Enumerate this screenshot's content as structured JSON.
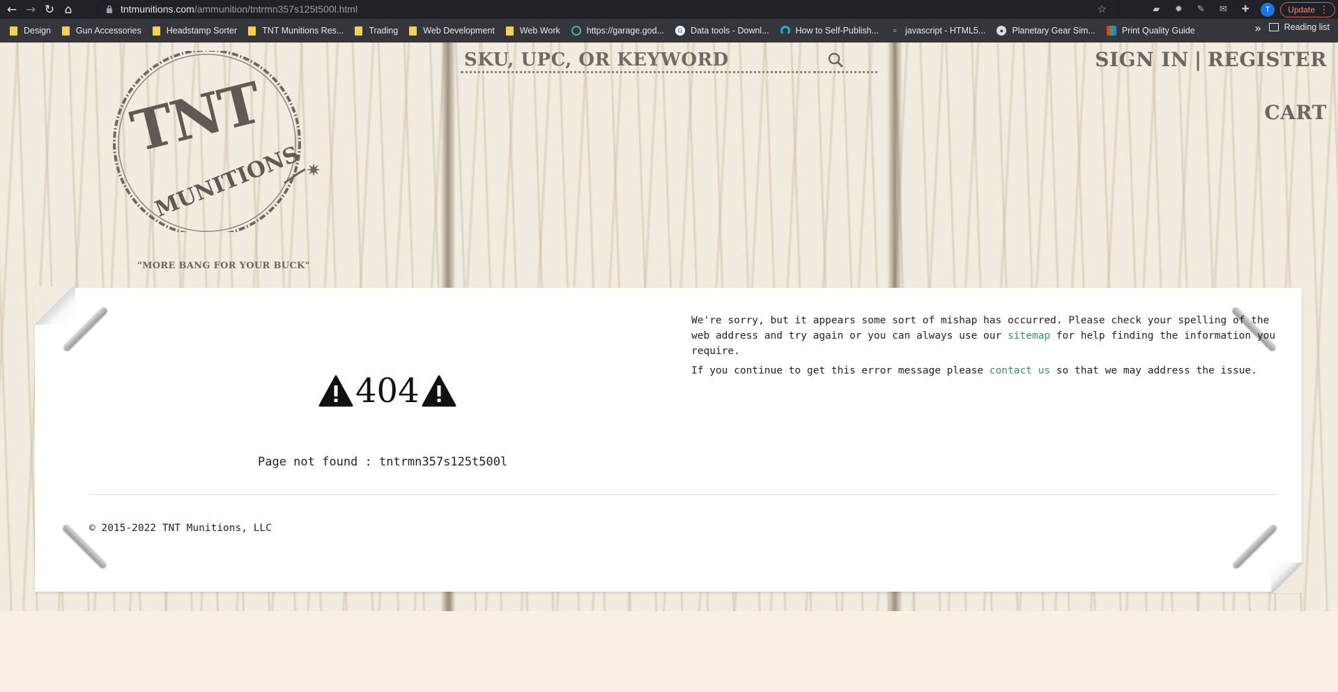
{
  "browser": {
    "url_host": "tntmunitions.com",
    "url_path": "/ammunition/tntrmn357s125t500l.html",
    "avatar_letter": "T",
    "update_label": "Update",
    "reading_list_label": "Reading list",
    "bookmarks": [
      {
        "label": "Design",
        "icon": "folder-icon"
      },
      {
        "label": "Gun Accessories",
        "icon": "folder-icon"
      },
      {
        "label": "Headstamp Sorter",
        "icon": "folder-icon"
      },
      {
        "label": "TNT Munitions Res...",
        "icon": "folder-icon"
      },
      {
        "label": "Trading",
        "icon": "folder-icon"
      },
      {
        "label": "Web Development",
        "icon": "folder-icon"
      },
      {
        "label": "Web Work",
        "icon": "folder-icon"
      },
      {
        "label": "https://garage.god...",
        "icon": "garage-favicon"
      },
      {
        "label": "Data tools - Downl...",
        "icon": "google-favicon"
      },
      {
        "label": "How to Self-Publish...",
        "icon": "blue-favicon"
      },
      {
        "label": "javascript - HTML5...",
        "icon": "stackoverflow-favicon"
      },
      {
        "label": "Planetary Gear Sim...",
        "icon": "globe-favicon"
      },
      {
        "label": "Print Quality Guide",
        "icon": "colorful-favicon"
      }
    ]
  },
  "site": {
    "tagline": "\"MORE BANG FOR YOUR BUCK\"",
    "logo_text_top": "TNT",
    "logo_text_bottom": "MUNITIONS",
    "search_placeholder": "SKU, UPC, OR KEYWORD",
    "sign_in": "SIGN IN",
    "separator": "|",
    "register": "REGISTER",
    "cart": "CART"
  },
  "error": {
    "code": "404",
    "not_found_text": "Page not found : tntrmn357s125t500l",
    "message_1_pre": "We're sorry, but it appears some sort of mishap has occurred. Please check your spelling of the web address and try again or you can always use our ",
    "message_1_link": "sitemap",
    "message_1_post": " for help finding the information you require.",
    "message_2_pre": "If you continue to get this error message please ",
    "message_2_link": "contact us",
    "message_2_post": " so that we may address the issue."
  },
  "footer": {
    "copyright": "© 2015-2022 TNT Munitions, LLC"
  },
  "colors": {
    "link": "#3f8b5f",
    "wood_text": "#6b665f",
    "chrome_bg": "#202124",
    "bookmark_bar": "#35363a"
  }
}
